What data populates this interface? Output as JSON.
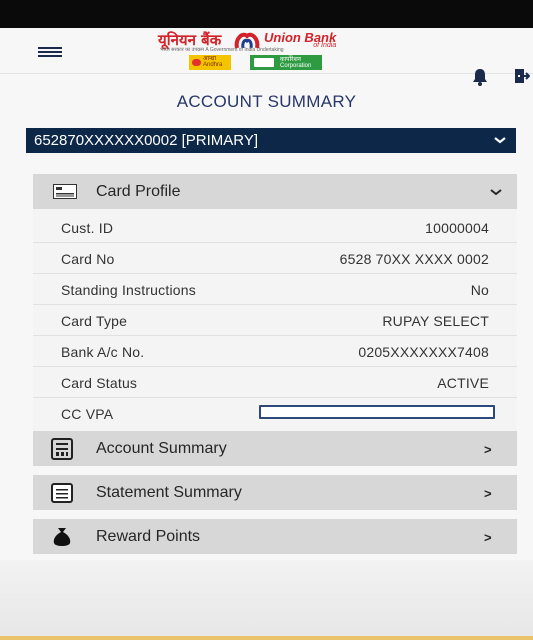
{
  "header": {
    "logo_hindi": "यूनियन बैंक",
    "logo_english": "Union Bank",
    "logo_english_sub": "of India",
    "logo_tagline": "भारत सरकार का उपक्रम   A Government of India Undertaking",
    "badge_andhra": "आन्ध्रा Andhra",
    "badge_corporation": "कार्पोरेशन Corporation"
  },
  "page": {
    "title": "ACCOUNT SUMMARY"
  },
  "account_select": {
    "value": "652870XXXXXX0002 [PRIMARY]"
  },
  "card_profile": {
    "title": "Card Profile",
    "rows": [
      {
        "label": "Cust. ID",
        "value": "10000004"
      },
      {
        "label": "Card No",
        "value": "6528 70XX XXXX 0002"
      },
      {
        "label": "Standing Instructions",
        "value": "No"
      },
      {
        "label": "Card Type",
        "value": "RUPAY SELECT"
      },
      {
        "label": "Bank A/c No.",
        "value": "0205XXXXXXX7408"
      },
      {
        "label": "Card Status",
        "value": "ACTIVE"
      },
      {
        "label": "CC VPA",
        "value": ""
      }
    ]
  },
  "menu": [
    {
      "label": "Account Summary",
      "arrow": ">",
      "icon": "account-summary-icon"
    },
    {
      "label": "Statement Summary",
      "arrow": ">",
      "icon": "statement-icon"
    },
    {
      "label": "Reward Points",
      "arrow": ">",
      "icon": "money-bag-icon"
    }
  ],
  "colors": {
    "navy": "#0c2747",
    "title": "#27376a",
    "brand_red": "#d2232a",
    "section_gray": "#d7d7d7"
  }
}
